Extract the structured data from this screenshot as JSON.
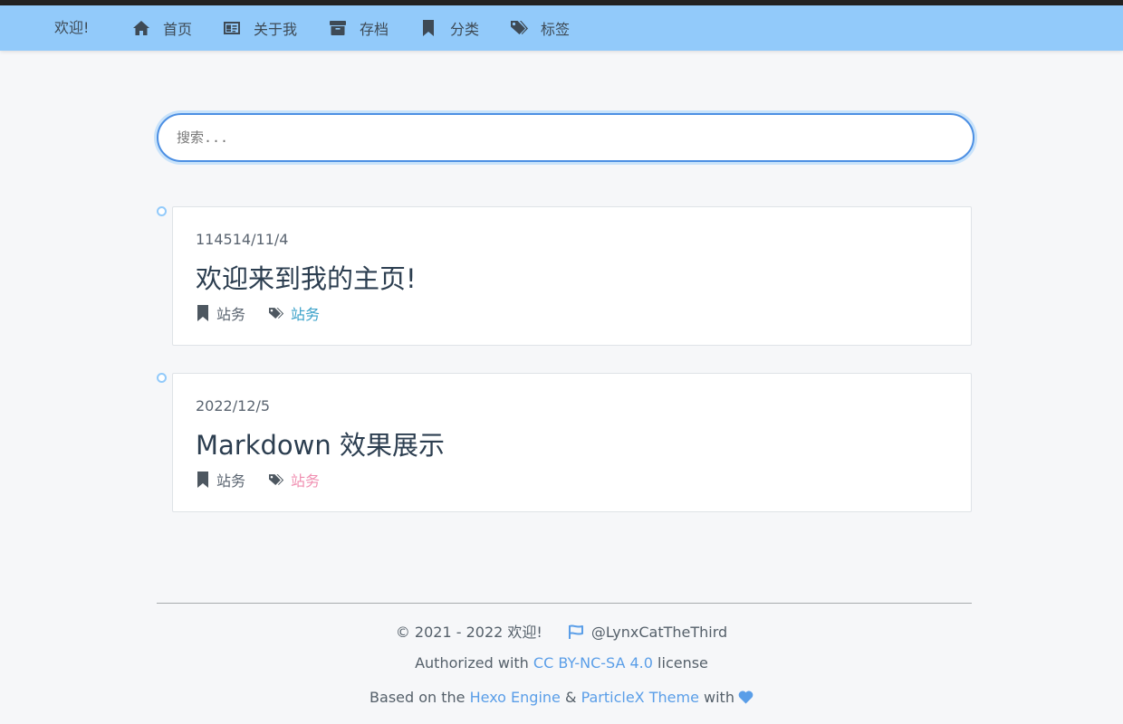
{
  "nav": {
    "brand": "欢迎!",
    "items": [
      {
        "label": "首页",
        "icon": "home-icon"
      },
      {
        "label": "关于我",
        "icon": "id-card-icon"
      },
      {
        "label": "存档",
        "icon": "archive-icon"
      },
      {
        "label": "分类",
        "icon": "bookmark-icon"
      },
      {
        "label": "标签",
        "icon": "tags-icon"
      }
    ]
  },
  "search": {
    "placeholder": "搜索..."
  },
  "posts": [
    {
      "date": "114514/11/4",
      "title": "欢迎来到我的主页!",
      "category": "站务",
      "tag": "站务",
      "tag_color": "#3aa1c9"
    },
    {
      "date": "2022/12/5",
      "title": "Markdown 效果展示",
      "category": "站务",
      "tag": "站务",
      "tag_color": "#f08fb1"
    }
  ],
  "footer": {
    "copyright": "© 2021 - 2022 欢迎!",
    "author": "@LynxCatTheThird",
    "license_prefix": "Authorized with",
    "license_link": "CC BY-NC-SA 4.0",
    "license_suffix": "license",
    "based_prefix": "Based on the",
    "engine_link": "Hexo Engine",
    "amp": "&",
    "theme_link": "ParticleX Theme",
    "with": "with"
  },
  "colors": {
    "navbar": "#92cafa",
    "link": "#5a9ee8",
    "search_border": "#4c8fe3"
  }
}
